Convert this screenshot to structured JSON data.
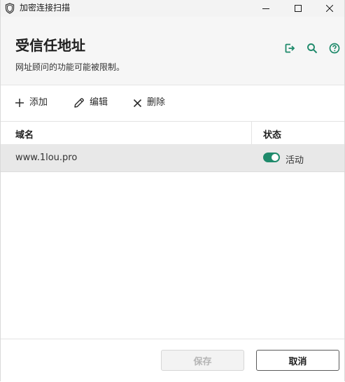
{
  "window": {
    "title": "加密连接扫描",
    "app_icon": "shield-icon",
    "controls": [
      "minimize-icon",
      "maximize-icon",
      "close-icon"
    ]
  },
  "header": {
    "title": "受信任地址",
    "subtitle": "网址顾问的功能可能被限制。",
    "icons": [
      "export-icon",
      "search-icon",
      "help-icon"
    ]
  },
  "toolbar": {
    "add_label": "添加",
    "edit_label": "编辑",
    "delete_label": "删除"
  },
  "table": {
    "columns": [
      "域名",
      "状态"
    ],
    "rows": [
      {
        "domain": "www.1lou.pro",
        "status": "活动",
        "enabled": true
      }
    ]
  },
  "footer": {
    "save_label": "保存",
    "cancel_label": "取消"
  },
  "colors": {
    "accent": "#1f8a6b",
    "header_bg": "#f6f6f6",
    "selected_row_bg": "#e8e8e8"
  }
}
